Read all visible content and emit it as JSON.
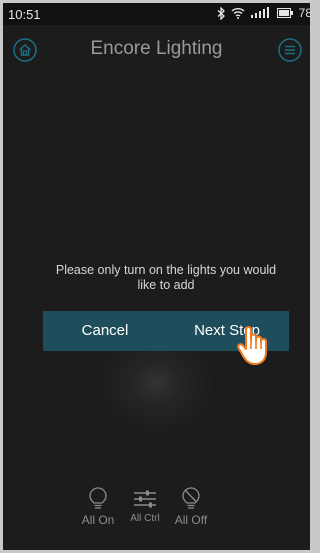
{
  "status_bar": {
    "time": "10:51",
    "battery": "78"
  },
  "header": {
    "title": "Encore Lighting"
  },
  "dialog": {
    "message": "Please only turn on the lights you would like to add",
    "cancel_label": "Cancel",
    "next_label": "Next Step"
  },
  "bottom_bar": {
    "all_on": "All On",
    "all_ctrl": "All Ctrl",
    "all_off": "All Off"
  },
  "colors": {
    "screen_bg": "#1c1c1c",
    "action_bar": "#1e4d5c",
    "accent_icon": "#1e6f86",
    "pointer_hand": "#f07a1c"
  },
  "icons": [
    "bluetooth-icon",
    "wifi-icon",
    "signal-icon",
    "battery-icon",
    "home-icon",
    "menu-icon",
    "bulb-icon",
    "sliders-icon",
    "bulb-off-icon",
    "pointer-hand-icon"
  ]
}
